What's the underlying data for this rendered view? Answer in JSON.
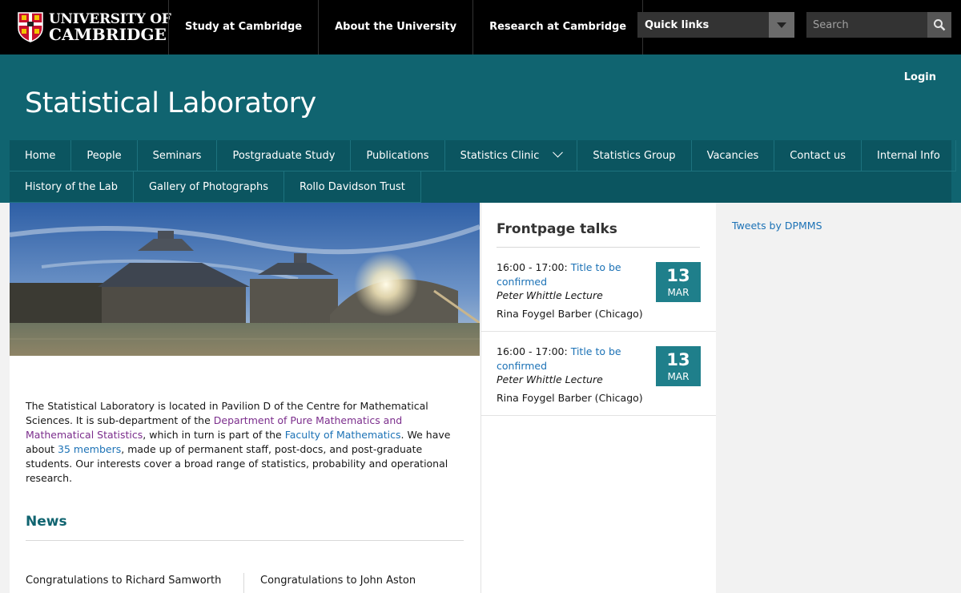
{
  "header_bar": {
    "logo_line1": "UNIVERSITY OF",
    "logo_line2": "CAMBRIDGE",
    "nav": [
      "Study at Cambridge",
      "About the University",
      "Research at Cambridge"
    ],
    "quick_links": "Quick links",
    "search_placeholder": "Search"
  },
  "site": {
    "login": "Login",
    "title": "Statistical Laboratory"
  },
  "main_nav": {
    "row1": [
      "Home",
      "People",
      "Seminars",
      "Postgraduate Study",
      "Publications",
      "Statistics Clinic",
      "Statistics Group",
      "Vacancies",
      "Contact us",
      "Internal Info"
    ],
    "row2": [
      "History of the Lab",
      "Gallery of Photographs",
      "Rollo Davidson Trust"
    ]
  },
  "intro": {
    "p1": "The Statistical Laboratory is located in Pavilion D of the Centre for Mathematical Sciences. It is sub-department of the ",
    "link_dpmms": "Department of Pure Mathematics and Mathematical Statistics",
    "p2": ", which in turn is part of the ",
    "link_faculty": "Faculty of Mathematics",
    "p3": ". We have about ",
    "link_members": "35 members",
    "p4": ", made up of permanent staff, post-docs, and post-graduate students. Our interests cover a broad range of statistics, probability and operational research."
  },
  "news": {
    "heading": "News",
    "items": [
      "Congratulations to Richard Samworth",
      "Congratulations to John Aston"
    ]
  },
  "talks": {
    "heading": "Frontpage talks",
    "items": [
      {
        "time": "16:00 - 17:00: ",
        "title": "Title to be confirmed",
        "series": "Peter Whittle Lecture",
        "speaker": "Rina Foygel Barber (Chicago)",
        "day": "13",
        "month": "MAR"
      },
      {
        "time": "16:00 - 17:00: ",
        "title": "Title to be confirmed",
        "series": "Peter Whittle Lecture",
        "speaker": "Rina Foygel Barber (Chicago)",
        "day": "13",
        "month": "MAR"
      }
    ]
  },
  "tweets": "Tweets by DPMMS",
  "colors": {
    "top_bar": "#000000",
    "header_teal": "#106470",
    "nav_teal": "#0b5560",
    "date_box": "#1f7f8b",
    "link_blue": "#1c72b6",
    "link_purple": "#7b2d8c",
    "news_heading": "#106470"
  }
}
